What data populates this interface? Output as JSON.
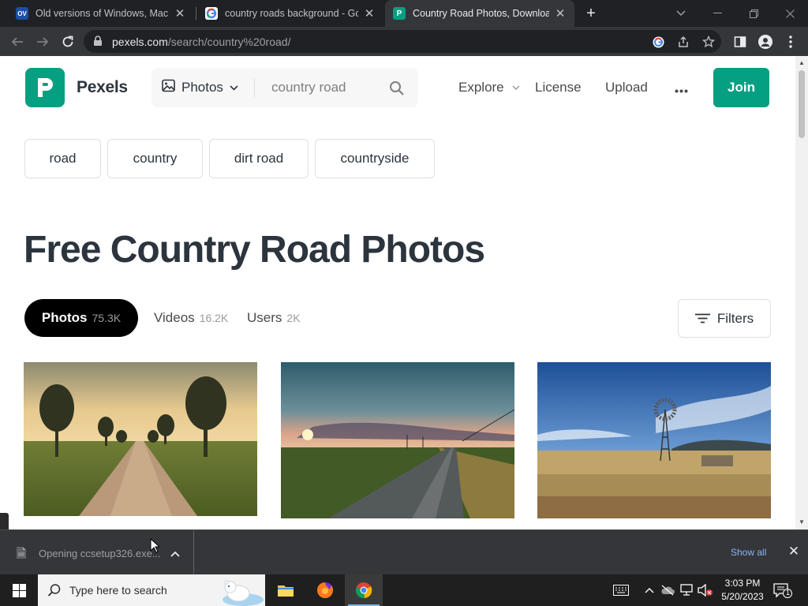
{
  "browser": {
    "tabs": [
      {
        "title": "Old versions of Windows, Mac an",
        "favicon": "OV",
        "active": false
      },
      {
        "title": "country roads background - Goo",
        "favicon": "G",
        "active": false
      },
      {
        "title": "Country Road Photos, Download",
        "favicon": "P",
        "active": true
      }
    ],
    "url_host": "pexels.com",
    "url_path": "/search/country%20road/"
  },
  "site": {
    "brand": "Pexels",
    "search": {
      "type_label": "Photos",
      "query": "country road"
    },
    "nav": {
      "explore": "Explore",
      "license": "License",
      "upload": "Upload",
      "join": "Join"
    },
    "related_chips": [
      "road",
      "country",
      "dirt road",
      "countryside"
    ],
    "title": "Free Country Road Photos",
    "media_tabs": [
      {
        "label": "Photos",
        "count": "75.3K"
      },
      {
        "label": "Videos",
        "count": "16.2K"
      },
      {
        "label": "Users",
        "count": "2K"
      }
    ],
    "filters_label": "Filters"
  },
  "downloads": {
    "item_text": "Opening ccsetup326.exe...",
    "show_all": "Show all"
  },
  "taskbar": {
    "search_placeholder": "Type here to search",
    "time": "3:03 PM",
    "date": "5/20/2023",
    "notification_count": "1"
  },
  "colors": {
    "brand_green": "#05a081",
    "chrome_dark": "#202124",
    "chrome_toolbar": "#35363a",
    "link_blue": "#8ab4f8"
  }
}
